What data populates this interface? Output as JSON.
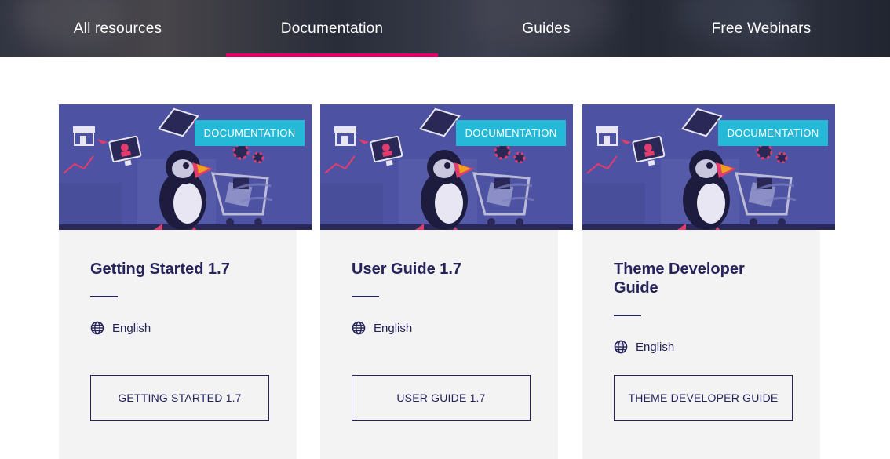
{
  "nav": {
    "tabs": [
      {
        "label": "All resources"
      },
      {
        "label": "Documentation",
        "active": true
      },
      {
        "label": "Guides"
      },
      {
        "label": "Free Webinars"
      }
    ],
    "active_color": "#df0067"
  },
  "cards": [
    {
      "badge": "DOCUMENTATION",
      "title": "Getting Started 1.7",
      "language": "English",
      "button": "GETTING STARTED 1.7"
    },
    {
      "badge": "DOCUMENTATION",
      "title": "User Guide 1.7",
      "language": "English",
      "button": "USER GUIDE 1.7"
    },
    {
      "badge": "DOCUMENTATION",
      "title": "Theme Developer Guide",
      "language": "English",
      "button": "THEME DEVELOPER GUIDE"
    }
  ],
  "colors": {
    "badge": "#25b9d7",
    "text": "#25235a",
    "card_body": "#f4f3f4",
    "thumb": "#4d53a2"
  },
  "icons": {
    "language": "globe-icon",
    "illustration": "puffin-shopping-cart-illustration"
  }
}
